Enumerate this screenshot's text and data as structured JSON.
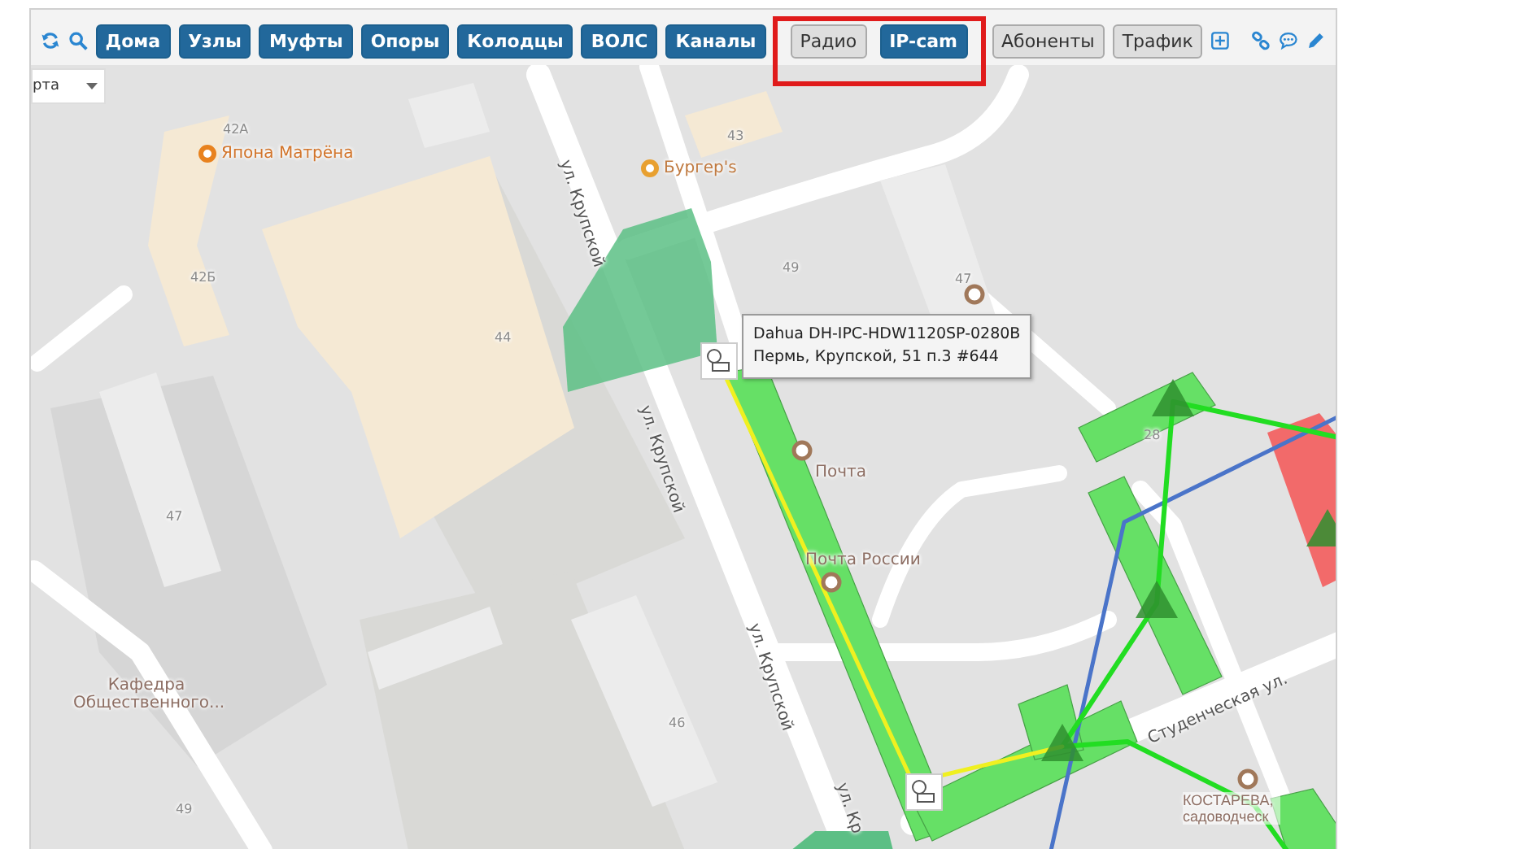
{
  "toolbar": {
    "buttons": [
      {
        "label": "Дома",
        "on": true,
        "highlighted": false
      },
      {
        "label": "Узлы",
        "on": true,
        "highlighted": false
      },
      {
        "label": "Муфты",
        "on": true,
        "highlighted": false
      },
      {
        "label": "Опоры",
        "on": true,
        "highlighted": false
      },
      {
        "label": "Колодцы",
        "on": true,
        "highlighted": false
      },
      {
        "label": "ВОЛС",
        "on": true,
        "highlighted": false
      },
      {
        "label": "Каналы",
        "on": true,
        "highlighted": false
      },
      {
        "label": "Радио",
        "on": false,
        "highlighted": true
      },
      {
        "label": "IP-cam",
        "on": true,
        "highlighted": true
      },
      {
        "label": "Абоненты",
        "on": false,
        "highlighted": false
      },
      {
        "label": "Трафик",
        "on": false,
        "highlighted": false
      }
    ]
  },
  "map_type_select": {
    "value": "рта"
  },
  "map": {
    "labels": [
      {
        "kind": "number",
        "text": "42А"
      },
      {
        "kind": "poi",
        "text": "Япона Матрёна"
      },
      {
        "kind": "number",
        "text": "43"
      },
      {
        "kind": "poi",
        "text": "Бургер's"
      },
      {
        "kind": "street",
        "text": "ул. Крупской"
      },
      {
        "kind": "number",
        "text": "49"
      },
      {
        "kind": "number",
        "text": "47"
      },
      {
        "kind": "number",
        "text": "42Б"
      },
      {
        "kind": "number",
        "text": "44"
      },
      {
        "kind": "street",
        "text": "ул. Крупской"
      },
      {
        "kind": "poi",
        "text": "Почта"
      },
      {
        "kind": "number",
        "text": "28"
      },
      {
        "kind": "number",
        "text": "47"
      },
      {
        "kind": "poi",
        "text": "Почта России"
      },
      {
        "kind": "street",
        "text": "ул. Крупской"
      },
      {
        "kind": "place",
        "text": "Кафедра Общественного..."
      },
      {
        "kind": "number",
        "text": "46"
      },
      {
        "kind": "street",
        "text": "Студенческая ул."
      },
      {
        "kind": "number",
        "text": "49"
      },
      {
        "kind": "poi",
        "text": "КОСТАРЕВА, садоводческ"
      },
      {
        "kind": "street",
        "text": "ул. Кр"
      }
    ],
    "tooltip": {
      "lines": [
        "Dahua DH-IPC-HDW1120SP-0280B",
        "Пермь, Крупской, 51 п.3 #644"
      ]
    }
  }
}
